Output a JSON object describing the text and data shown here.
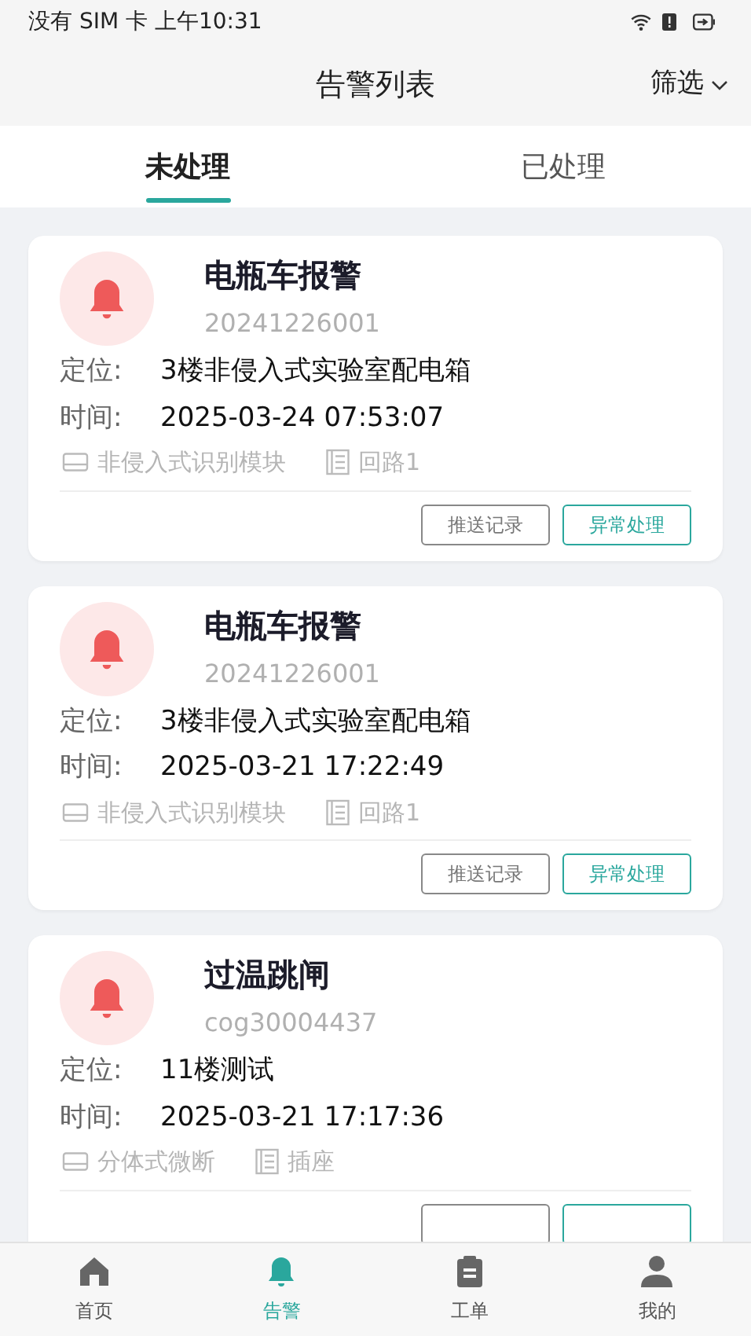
{
  "status_bar": {
    "carrier_time": "没有 SIM 卡 上午10:31"
  },
  "header": {
    "title": "告警列表",
    "filter": "筛选"
  },
  "tabs": [
    {
      "label": "未处理",
      "selected": true
    },
    {
      "label": "已处理",
      "selected": false
    }
  ],
  "alarms": [
    {
      "title": "电瓶车报警",
      "code": "20241226001",
      "location_label": "定位:",
      "location": "3楼非侵入式实验室配电箱",
      "time_label": "时间:",
      "time": "2025-03-24 07:53:07",
      "device": "非侵入式识别模块",
      "circuit": "回路1",
      "buttons": [
        "推送记录",
        "异常处理"
      ]
    },
    {
      "title": "电瓶车报警",
      "code": "20241226001",
      "location_label": "定位:",
      "location": "3楼非侵入式实验室配电箱",
      "time_label": "时间:",
      "time": "2025-03-21 17:22:49",
      "device": "非侵入式识别模块",
      "circuit": "回路1",
      "buttons": [
        "推送记录",
        "异常处理"
      ]
    },
    {
      "title": "过温跳闸",
      "code": "cog30004437",
      "location_label": "定位:",
      "location": "11楼测试",
      "time_label": "时间:",
      "time": "2025-03-21 17:17:36",
      "device": "分体式微断",
      "circuit": "插座",
      "buttons_hidden": true
    }
  ],
  "bottom_nav": [
    {
      "kind": "home",
      "label": "首页",
      "selected": false
    },
    {
      "kind": "bell",
      "label": "告警",
      "selected": true
    },
    {
      "kind": "clipboard",
      "label": "工单",
      "selected": false
    },
    {
      "kind": "person",
      "label": "我的",
      "selected": false
    }
  ]
}
